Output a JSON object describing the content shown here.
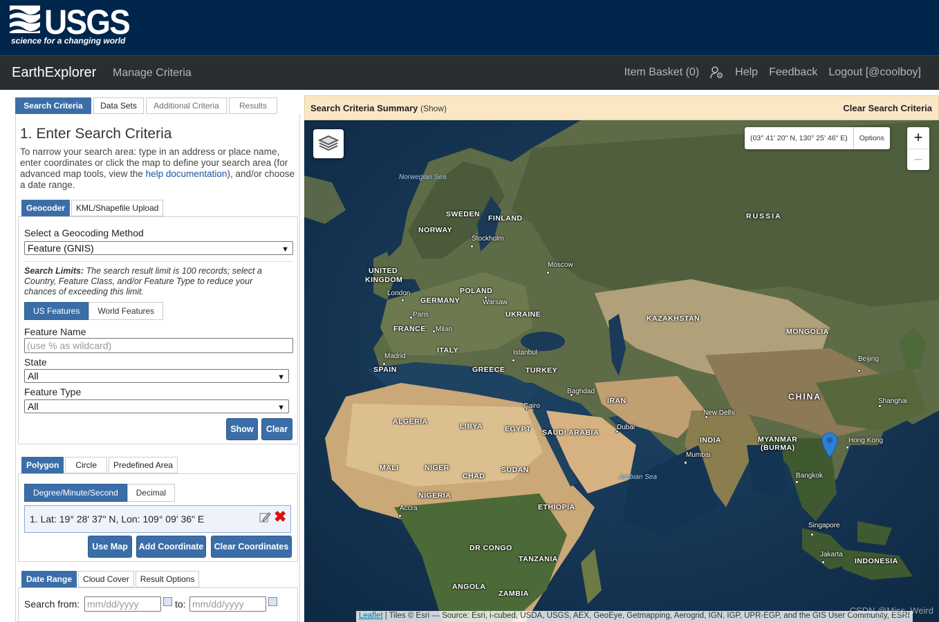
{
  "usgs": {
    "logo_word": "USGS",
    "tagline": "science for a changing world"
  },
  "nav": {
    "brand": "EarthExplorer",
    "manage": "Manage Criteria",
    "item_basket": "Item Basket (0)",
    "help": "Help",
    "feedback": "Feedback",
    "logout": "Logout [@coolboy]"
  },
  "tabs": [
    "Search Criteria",
    "Data Sets",
    "Additional Criteria",
    "Results"
  ],
  "criteria": {
    "title": "1. Enter Search Criteria",
    "intro_a": "To narrow your search area: type in an address or place name, enter coordinates or click the map to define your search area (for advanced map tools, view the ",
    "intro_link": "help documentation",
    "intro_b": "), and/or choose a date range."
  },
  "geo_tabs": [
    "Geocoder",
    "KML/Shapefile Upload"
  ],
  "geocoder": {
    "method_label": "Select a Geocoding Method",
    "method_value": "Feature (GNIS)",
    "limits_bold": "Search Limits:",
    "limits_text": " The search result limit is 100 records; select a Country, Feature Class, and/or Feature Type to reduce your chances of exceeding this limit.",
    "toggle": [
      "US Features",
      "World Features"
    ],
    "feature_name_label": "Feature Name",
    "feature_name_placeholder": "(use % as wildcard)",
    "state_label": "State",
    "state_value": "All",
    "type_label": "Feature Type",
    "type_value": "All",
    "show": "Show",
    "clear": "Clear"
  },
  "area_tabs": [
    "Polygon",
    "Circle",
    "Predefined Area"
  ],
  "polygon": {
    "toggle": [
      "Degree/Minute/Second",
      "Decimal"
    ],
    "coordinate": "1.  Lat: 19° 28' 37\" N, Lon: 109° 09' 36\" E",
    "use_map": "Use Map",
    "add": "Add Coordinate",
    "clear": "Clear Coordinates"
  },
  "date_tabs": [
    "Date Range",
    "Cloud Cover",
    "Result Options"
  ],
  "date": {
    "from_label": "Search from:",
    "from_placeholder": "mm/dd/yyyy",
    "to_label": "to:",
    "to_placeholder": "mm/dd/yyyy"
  },
  "summary": {
    "title": "Search Criteria Summary",
    "show": "(Show)",
    "clear": "Clear Search Criteria"
  },
  "map": {
    "coords": "(03° 41' 20\" N, 130° 25' 46\" E)",
    "options": "Options",
    "zoom_in": "+",
    "zoom_out": "−",
    "attribution_link": "Leaflet",
    "attribution": " | Tiles © Esri — Source: Esri, i-cubed, USDA, USGS, AEX, GeoEye, Getmapping, Aerogrid, IGN, IGP, UPR-EGP, and the GIS User Community, ESRI",
    "watermark": "CSDN @Miss_Weird",
    "countries": [
      "RUSSIA",
      "SWEDEN",
      "FINLAND",
      "NORWAY",
      "UNITED",
      "KINGDOM",
      "POLAND",
      "GERMANY",
      "UKRAINE",
      "FRANCE",
      "KAZAKHSTAN",
      "MONGOLIA",
      "ITALY",
      "SPAIN",
      "GREECE",
      "TURKEY",
      "CHINA",
      "IRAN",
      "ALGERIA",
      "LIBYA",
      "EGYPT",
      "SAUDI ARABIA",
      "INDIA",
      "MYANMAR",
      "(BURMA)",
      "MALI",
      "NIGER",
      "CHAD",
      "SUDAN",
      "NIGERIA",
      "ETHIOPIA",
      "DR CONGO",
      "TANZANIA",
      "INDONESIA",
      "ANGOLA",
      "ZAMBIA"
    ],
    "cities": [
      "Stockholm",
      "Moscow",
      "London",
      "Warsaw",
      "Paris",
      "Milan",
      "Madrid",
      "Istanbul",
      "Beijing",
      "Shanghai",
      "Baghdad",
      "Cairo",
      "Dubai",
      "New Delhi",
      "Hong Kong",
      "Mumbai",
      "Bangkok",
      "Accra",
      "Singapore",
      "Jakarta"
    ],
    "seas": [
      "Norwegian Sea",
      "Arabian Sea"
    ]
  },
  "colors": {
    "usgs_blue": "#00264c",
    "nav_dark": "#2b2e31",
    "accent": "#3b6ea8",
    "summary_bg": "#fbe7c6",
    "marker": "#2f7fd3"
  }
}
